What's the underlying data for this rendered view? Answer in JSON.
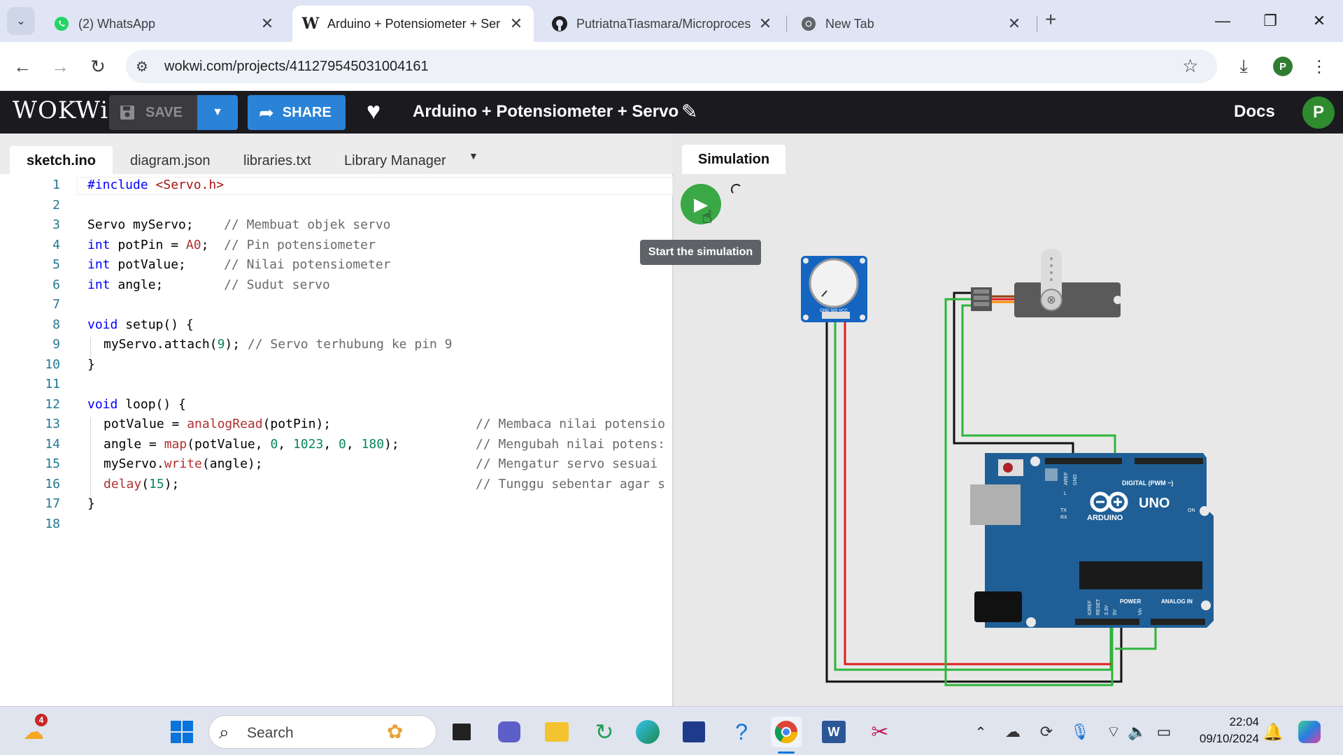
{
  "browser": {
    "tabs": [
      {
        "title": "(2) WhatsApp",
        "icon": "whatsapp-icon"
      },
      {
        "title": "Arduino + Potensiometer + Ser",
        "icon": "wokwi-icon"
      },
      {
        "title": "PutriatnaTiasmara/Microproces",
        "icon": "github-icon"
      },
      {
        "title": "New Tab",
        "icon": "chrome-icon"
      }
    ],
    "url": "wokwi.com/projects/411279545031004161",
    "profile_initial": "P"
  },
  "wokwi": {
    "logo": "WOKWi",
    "save_label": "SAVE",
    "share_label": "SHARE",
    "project_title": "Arduino + Potensiometer + Servo",
    "docs_label": "Docs",
    "user_initial": "P",
    "colors": {
      "header": "#1b1b1f",
      "accent": "#2a83d7",
      "play": "#3aa845"
    }
  },
  "editor": {
    "tabs": [
      "sketch.ino",
      "diagram.json",
      "libraries.txt",
      "Library Manager"
    ],
    "line_numbers": [
      "1",
      "2",
      "3",
      "4",
      "5",
      "6",
      "7",
      "8",
      "9",
      "10",
      "11",
      "12",
      "13",
      "14",
      "15",
      "16",
      "17",
      "18"
    ],
    "code": {
      "l1a": "#include",
      "l1b": " <Servo.h>",
      "l3a": "Servo myServo;    ",
      "l3b": "// Membuat objek servo",
      "l4a": "int",
      "l4b": " potPin = ",
      "l4c": "A0",
      "l4d": ";  ",
      "l4e": "// Pin potensiometer",
      "l5a": "int",
      "l5b": " potValue;     ",
      "l5c": "// Nilai potensiometer",
      "l6a": "int",
      "l6b": " angle;        ",
      "l6c": "// Sudut servo",
      "l8a": "void",
      "l8b": " setup() {",
      "l9a": "myServo.attach(",
      "l9b": "9",
      "l9c": "); ",
      "l9d": "// Servo terhubung ke pin 9",
      "l10": "}",
      "l12a": "void",
      "l12b": " loop() {",
      "l13a": "potValue = ",
      "l13b": "analogRead",
      "l13c": "(potPin);",
      "l13d": "// Membaca nilai potensio",
      "l14a": "angle = ",
      "l14b": "map",
      "l14c": "(potValue, ",
      "l14d": "0",
      "l14e": ", ",
      "l14f": "1023",
      "l14g": ", ",
      "l14h": "0",
      "l14i": ", ",
      "l14j": "180",
      "l14k": ");",
      "l14l": "// Mengubah nilai potens:",
      "l15a": "myServo.",
      "l15b": "write",
      "l15c": "(angle);",
      "l15d": "// Mengatur servo sesuai",
      "l16a": "delay",
      "l16b": "(",
      "l16c": "15",
      "l16d": ");",
      "l16e": "// Tunggu sebentar agar s",
      "l17": "}"
    }
  },
  "simulation": {
    "tab_label": "Simulation",
    "tooltip": "Start the simulation",
    "board_labels": {
      "digital": "DIGITAL (PWM ~)",
      "brand": "ARDUINO",
      "model": "UNO",
      "on": "ON",
      "tx": "TX",
      "rx": "RX",
      "l": "L",
      "power": "POWER",
      "analog": "ANALOG IN",
      "aref": "AREF",
      "gnd": "GND",
      "ioref": "IOREF",
      "reset": "RESET",
      "v33": "3.3V",
      "v5": "5V",
      "vin": "Vin",
      "pot_pins": "GND SIG VCC"
    }
  },
  "taskbar": {
    "search_placeholder": "Search",
    "weather_badge": "4",
    "time": "22:04",
    "date": "09/10/2024"
  }
}
